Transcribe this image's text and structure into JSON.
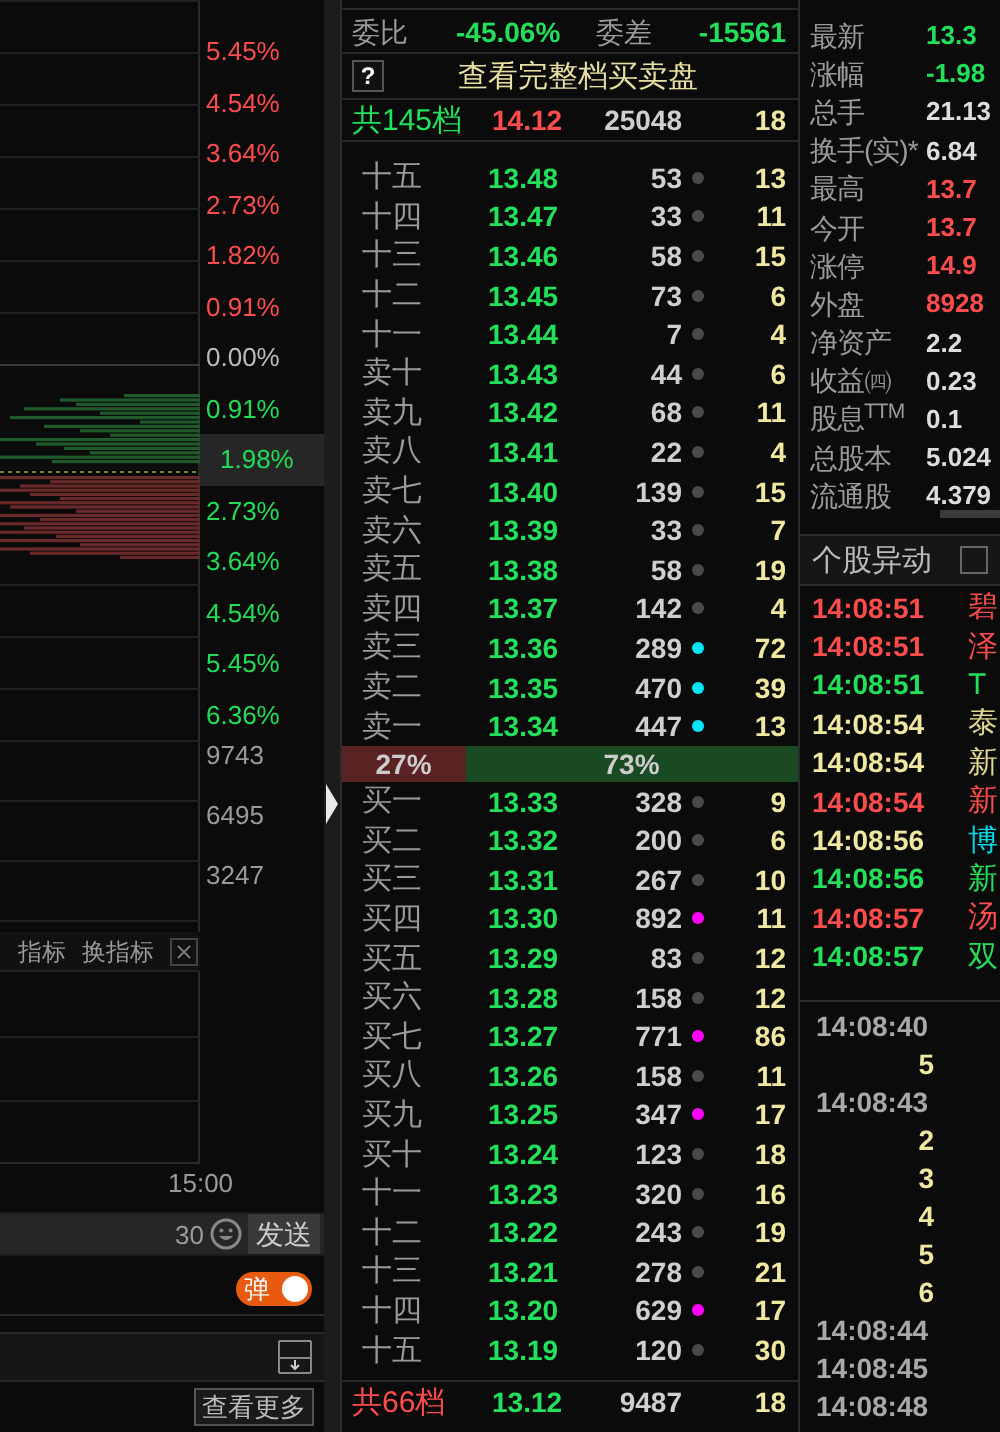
{
  "depth_axis": [
    {
      "text": "5.45%",
      "kind": "up"
    },
    {
      "text": "4.54%",
      "kind": "up"
    },
    {
      "text": "3.64%",
      "kind": "up"
    },
    {
      "text": "2.73%",
      "kind": "up"
    },
    {
      "text": "1.82%",
      "kind": "up"
    },
    {
      "text": "0.91%",
      "kind": "up"
    },
    {
      "text": "0.00%",
      "kind": "flat"
    },
    {
      "text": "0.91%",
      "kind": "down"
    },
    {
      "text": "1.98%",
      "kind": "current"
    },
    {
      "text": "2.73%",
      "kind": "down"
    },
    {
      "text": "3.64%",
      "kind": "down"
    },
    {
      "text": "4.54%",
      "kind": "down"
    },
    {
      "text": "5.45%",
      "kind": "down"
    },
    {
      "text": "6.36%",
      "kind": "down"
    }
  ],
  "volume_axis": [
    "9743",
    "6495",
    "3247"
  ],
  "indicator_bar": {
    "items": [
      "指标",
      "换指标"
    ]
  },
  "time_axis": "15:00",
  "chat": {
    "count": "30",
    "send": "发送"
  },
  "popup_toggle": {
    "label": "弹",
    "on": true
  },
  "more_button": "查看更多",
  "order_book": {
    "ratio_label": "委比",
    "ratio": "-45.06%",
    "diff_label": "委差",
    "diff": "-15561",
    "help": "?",
    "full_link": "查看完整档买卖盘",
    "ask_total": {
      "kind": "ask",
      "label": "共145档",
      "price": "14.12",
      "volume": "25048",
      "count": "18"
    },
    "asks": [
      {
        "label": "十五",
        "price": "13.48",
        "volume": "53",
        "count": "13",
        "color": "#4a4a4a"
      },
      {
        "label": "十四",
        "price": "13.47",
        "volume": "33",
        "count": "11",
        "color": "#4a4a4a"
      },
      {
        "label": "十三",
        "price": "13.46",
        "volume": "58",
        "count": "15",
        "color": "#4a4a4a"
      },
      {
        "label": "十二",
        "price": "13.45",
        "volume": "73",
        "count": "6",
        "color": "#4a4a4a"
      },
      {
        "label": "十一",
        "price": "13.44",
        "volume": "7",
        "count": "4",
        "color": "#4a4a4a"
      },
      {
        "label": "卖十",
        "price": "13.43",
        "volume": "44",
        "count": "6",
        "color": "#4a4a4a"
      },
      {
        "label": "卖九",
        "price": "13.42",
        "volume": "68",
        "count": "11",
        "color": "#4a4a4a"
      },
      {
        "label": "卖八",
        "price": "13.41",
        "volume": "22",
        "count": "4",
        "color": "#4a4a4a"
      },
      {
        "label": "卖七",
        "price": "13.40",
        "volume": "139",
        "count": "15",
        "color": "#4a4a4a"
      },
      {
        "label": "卖六",
        "price": "13.39",
        "volume": "33",
        "count": "7",
        "color": "#4a4a4a"
      },
      {
        "label": "卖五",
        "price": "13.38",
        "volume": "58",
        "count": "19",
        "color": "#4a4a4a"
      },
      {
        "label": "卖四",
        "price": "13.37",
        "volume": "142",
        "count": "4",
        "color": "#4a4a4a"
      },
      {
        "label": "卖三",
        "price": "13.36",
        "volume": "289",
        "count": "72",
        "color": "#00e5ff"
      },
      {
        "label": "卖二",
        "price": "13.35",
        "volume": "470",
        "count": "39",
        "color": "#00e5ff"
      },
      {
        "label": "卖一",
        "price": "13.34",
        "volume": "447",
        "count": "13",
        "color": "#00e5ff"
      }
    ],
    "split": {
      "bid_pct": "27%",
      "ask_pct": "73%",
      "level": 0.27
    },
    "bids": [
      {
        "label": "买一",
        "price": "13.33",
        "volume": "328",
        "count": "9",
        "color": "#4a4a4a"
      },
      {
        "label": "买二",
        "price": "13.32",
        "volume": "200",
        "count": "6",
        "color": "#4a4a4a"
      },
      {
        "label": "买三",
        "price": "13.31",
        "volume": "267",
        "count": "10",
        "color": "#4a4a4a"
      },
      {
        "label": "买四",
        "price": "13.30",
        "volume": "892",
        "count": "11",
        "color": "#ff00ff"
      },
      {
        "label": "买五",
        "price": "13.29",
        "volume": "83",
        "count": "12",
        "color": "#4a4a4a"
      },
      {
        "label": "买六",
        "price": "13.28",
        "volume": "158",
        "count": "12",
        "color": "#4a4a4a"
      },
      {
        "label": "买七",
        "price": "13.27",
        "volume": "771",
        "count": "86",
        "color": "#ff00ff"
      },
      {
        "label": "买八",
        "price": "13.26",
        "volume": "158",
        "count": "11",
        "color": "#4a4a4a"
      },
      {
        "label": "买九",
        "price": "13.25",
        "volume": "347",
        "count": "17",
        "color": "#ff00ff"
      },
      {
        "label": "买十",
        "price": "13.24",
        "volume": "123",
        "count": "18",
        "color": "#4a4a4a"
      },
      {
        "label": "十一",
        "price": "13.23",
        "volume": "320",
        "count": "16",
        "color": "#4a4a4a"
      },
      {
        "label": "十二",
        "price": "13.22",
        "volume": "243",
        "count": "19",
        "color": "#4a4a4a"
      },
      {
        "label": "十三",
        "price": "13.21",
        "volume": "278",
        "count": "21",
        "color": "#4a4a4a"
      },
      {
        "label": "十四",
        "price": "13.20",
        "volume": "629",
        "count": "17",
        "color": "#ff00ff"
      },
      {
        "label": "十五",
        "price": "13.19",
        "volume": "120",
        "count": "30",
        "color": "#4a4a4a"
      }
    ],
    "bid_total": {
      "kind": "bid",
      "label": "共66档",
      "price": "13.12",
      "volume": "9487",
      "count": "18"
    }
  },
  "quote": [
    {
      "label": "最新",
      "value": "13.3",
      "color": "#22e05a"
    },
    {
      "label": "涨幅",
      "value": "-1.98",
      "color": "#22e05a"
    },
    {
      "label": "总手",
      "value": "21.13",
      "color": "#dddddd"
    },
    {
      "label": "换手(实)*",
      "value": "6.84",
      "color": "#dddddd"
    },
    {
      "label": "最高",
      "value": "13.7",
      "color": "#ff4d4d"
    },
    {
      "label": "今开",
      "value": "13.7",
      "color": "#ff4d4d"
    },
    {
      "label": "涨停",
      "value": "14.9",
      "color": "#ff4d4d"
    },
    {
      "label": "外盘",
      "value": "8928",
      "color": "#ff4d4d"
    },
    {
      "label": "净资产",
      "value": "2.2",
      "color": "#dddddd"
    },
    {
      "label": "收益㈣",
      "value": "0.23",
      "color": "#dddddd"
    },
    {
      "label": "股息$^{TTM}$",
      "value": "0.1",
      "color": "#dddddd"
    },
    {
      "label": "总股本",
      "value": "5.024",
      "color": "#dddddd"
    },
    {
      "label": "流通股",
      "value": "4.379",
      "color": "#dddddd"
    }
  ],
  "alerts": {
    "title": "个股异动",
    "checked": false,
    "items": [
      {
        "time": {
          "text": "14:08:51",
          "color": "#ff4d4d"
        },
        "name": {
          "text": "碧",
          "color": "#ff4d4d"
        }
      },
      {
        "time": {
          "text": "14:08:51",
          "color": "#ff4d4d"
        },
        "name": {
          "text": "泽",
          "color": "#ff4d4d"
        }
      },
      {
        "time": {
          "text": "14:08:51",
          "color": "#22e05a"
        },
        "name": {
          "text": "T",
          "color": "#22e05a"
        }
      },
      {
        "time": {
          "text": "14:08:54",
          "color": "#f0e8a0"
        },
        "name": {
          "text": "泰",
          "color": "#e0d890"
        }
      },
      {
        "time": {
          "text": "14:08:54",
          "color": "#f0e8a0"
        },
        "name": {
          "text": "新",
          "color": "#e0d890"
        }
      },
      {
        "time": {
          "text": "14:08:54",
          "color": "#ff4d4d"
        },
        "name": {
          "text": "新",
          "color": "#ff4d4d"
        }
      },
      {
        "time": {
          "text": "14:08:56",
          "color": "#f0e8a0"
        },
        "name": {
          "text": "博",
          "color": "#00d8e8"
        }
      },
      {
        "time": {
          "text": "14:08:56",
          "color": "#22e05a"
        },
        "name": {
          "text": "新",
          "color": "#22e05a"
        }
      },
      {
        "time": {
          "text": "14:08:57",
          "color": "#ff4d4d"
        },
        "name": {
          "text": "汤",
          "color": "#ff4d4d"
        }
      },
      {
        "time": {
          "text": "14:08:57",
          "color": "#22e05a"
        },
        "name": {
          "text": "双",
          "color": "#22e05a"
        }
      }
    ]
  },
  "ticks": [
    {
      "kind": "time",
      "text": "14:08:40"
    },
    {
      "kind": "count",
      "text": "5"
    },
    {
      "kind": "time",
      "text": "14:08:43"
    },
    {
      "kind": "count",
      "text": "2"
    },
    {
      "kind": "count",
      "text": "3"
    },
    {
      "kind": "count",
      "text": "4"
    },
    {
      "kind": "count",
      "text": "5"
    },
    {
      "kind": "count",
      "text": "6"
    },
    {
      "kind": "time",
      "text": "14:08:44"
    },
    {
      "kind": "time",
      "text": "14:08:45"
    },
    {
      "kind": "time",
      "text": "14:08:48"
    }
  ]
}
